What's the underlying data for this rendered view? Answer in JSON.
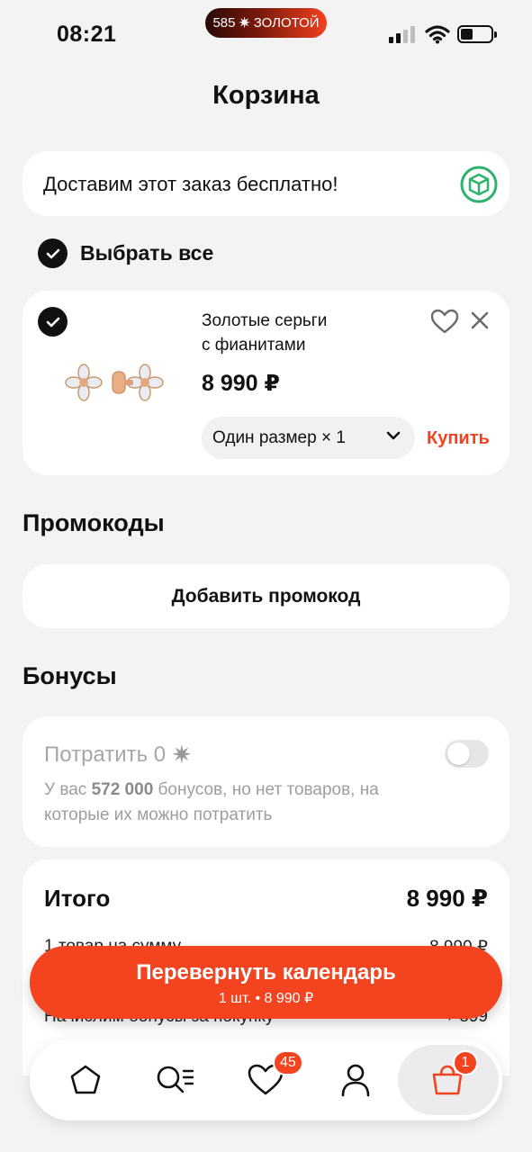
{
  "status_bar": {
    "time": "08:21",
    "island_left": "585",
    "island_right": "ЗОЛОТОЙ",
    "spark_icon": "sparkle-icon"
  },
  "header": {
    "title": "Корзина"
  },
  "delivery": {
    "text": "Доставим этот заказ бесплатно!",
    "icon": "box-icon",
    "icon_color": "#2db36b"
  },
  "select_all": {
    "label": "Выбрать все",
    "checked": true
  },
  "cart_item": {
    "name_line1": "Золотые серьги",
    "name_line2": "с фианитами",
    "price": "8 990 ₽",
    "size_label": "Один размер × 1",
    "buy_label": "Купить",
    "checked": true
  },
  "promocodes": {
    "heading": "Промокоды",
    "button_label": "Добавить промокод"
  },
  "bonuses": {
    "heading": "Бонусы",
    "spend_label": "Потратить 0",
    "desc_prefix": "У вас ",
    "desc_amount": "572 000",
    "desc_suffix": " бонусов, но нет товаров, на которые их можно потратить",
    "toggle_on": false
  },
  "summary": {
    "total_label": "Итого",
    "total_value": "8 990 ₽",
    "items_label": "1 товар на сумму",
    "items_value": "8 990 ₽",
    "bonus_label": "Начислим бонусы за покупку",
    "bonus_value": "+ 899"
  },
  "cta": {
    "label": "Перевернуть календарь",
    "sub": "1 шт. • 8 990 ₽",
    "color": "#f3431f"
  },
  "tabbar": {
    "items": [
      {
        "name": "home",
        "icon": "home-icon"
      },
      {
        "name": "catalog",
        "icon": "search-list-icon"
      },
      {
        "name": "favorites",
        "icon": "heart-icon",
        "badge": "45"
      },
      {
        "name": "profile",
        "icon": "user-icon"
      },
      {
        "name": "cart",
        "icon": "bag-icon",
        "badge": "1",
        "active": true
      }
    ]
  },
  "accent_color": "#f3431f"
}
